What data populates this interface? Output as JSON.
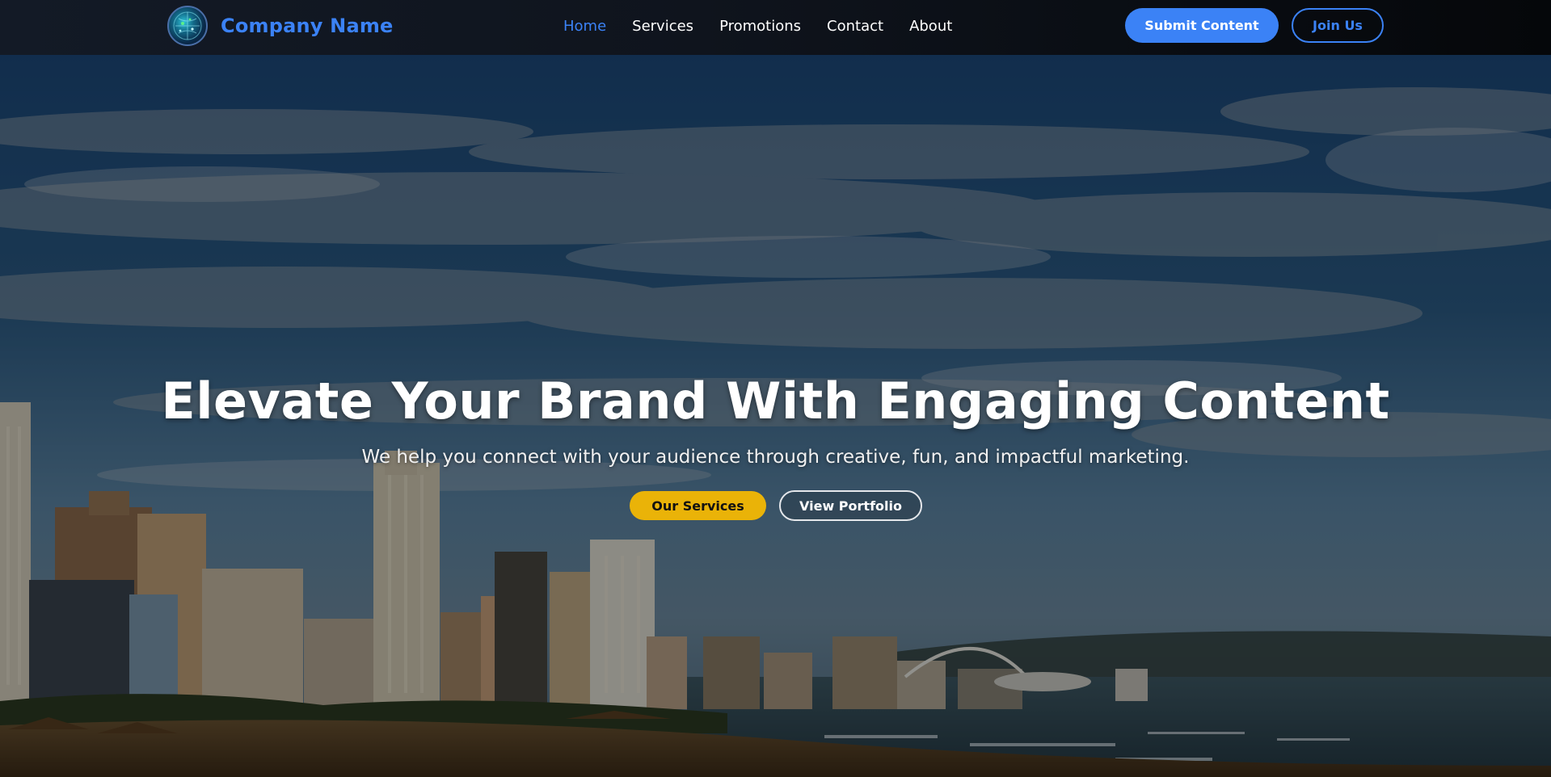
{
  "navbar": {
    "brand_name": "Company Name",
    "logo_icon": "globe-circuit-icon",
    "links": [
      {
        "label": "Home",
        "active": true
      },
      {
        "label": "Services",
        "active": false
      },
      {
        "label": "Promotions",
        "active": false
      },
      {
        "label": "Contact",
        "active": false
      },
      {
        "label": "About",
        "active": false
      }
    ],
    "submit_label": "Submit Content",
    "join_label": "Join Us"
  },
  "hero": {
    "title": "Elevate Your Brand With Engaging Content",
    "subtitle": "We help you connect with your audience through creative, fun, and impactful marketing.",
    "primary_button": "Our Services",
    "secondary_button": "View Portfolio",
    "background": "city-beach-skyline-photo"
  },
  "colors": {
    "accent_blue": "#3b82f6",
    "accent_yellow": "#eab308",
    "nav_bg": "#0f141d",
    "text_white": "#ffffff"
  }
}
